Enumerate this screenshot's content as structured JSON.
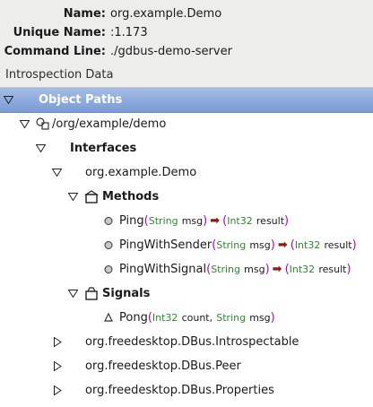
{
  "info": {
    "name_label": "Name:",
    "name_value": "org.example.Demo",
    "unique_label": "Unique Name:",
    "unique_value": ":1.173",
    "cmd_label": "Command Line:",
    "cmd_value": "./gdbus-demo-server"
  },
  "section_title": "Introspection Data",
  "tree": {
    "object_paths": "Object Paths",
    "path": "/org/example/demo",
    "interfaces": "Interfaces",
    "iface_demo": "org.example.Demo",
    "methods": "Methods",
    "signals": "Signals",
    "method_list": [
      {
        "name": "Ping",
        "lp": "(",
        "in_type": "String",
        "in_arg": "msg",
        "rp": ")",
        "arrow": "➡",
        "lp2": "(",
        "out_type": "Int32",
        "out_arg": "result",
        "rp2": ")"
      },
      {
        "name": "PingWithSender",
        "lp": "(",
        "in_type": "String",
        "in_arg": "msg",
        "rp": ")",
        "arrow": "➡",
        "lp2": "(",
        "out_type": "Int32",
        "out_arg": "result",
        "rp2": ")"
      },
      {
        "name": "PingWithSignal",
        "lp": "(",
        "in_type": "String",
        "in_arg": "msg",
        "rp": ")",
        "arrow": "➡",
        "lp2": "(",
        "out_type": "Int32",
        "out_arg": "result",
        "rp2": ")"
      }
    ],
    "signal_pong": {
      "name": "Pong",
      "lp": "(",
      "t1": "Int32",
      "a1": "count,",
      "t2": "String",
      "a2": "msg",
      "rp": ")"
    },
    "iface_introspectable": "org.freedesktop.DBus.Introspectable",
    "iface_peer": "org.freedesktop.DBus.Peer",
    "iface_properties": "org.freedesktop.DBus.Properties"
  },
  "colors": {
    "header_blue": "#7a9bd3",
    "paren": "#c000c0",
    "type": "#2e8b2e",
    "arrow": "#8b1a1a"
  }
}
